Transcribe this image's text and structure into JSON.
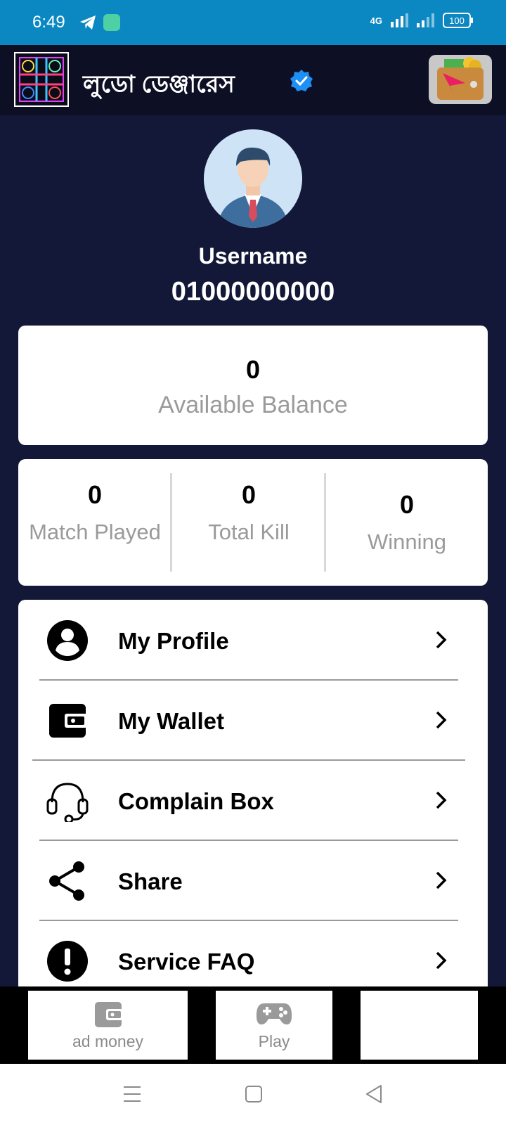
{
  "status_bar": {
    "time": "6:49",
    "network": "4G",
    "battery": "100"
  },
  "app_bar": {
    "title": "লুডো ডেঞ্জারেস"
  },
  "profile": {
    "username": "Username",
    "phone": "01000000000"
  },
  "balance": {
    "value": "0",
    "label": "Available Balance"
  },
  "stats": [
    {
      "value": "0",
      "label": "Match Played"
    },
    {
      "value": "0",
      "label": "Total Kill"
    },
    {
      "value": "0",
      "label": "Winning"
    }
  ],
  "menu": [
    {
      "label": "My Profile",
      "icon": "account-circle-icon"
    },
    {
      "label": "My Wallet",
      "icon": "wallet-icon"
    },
    {
      "label": "Complain Box",
      "icon": "headset-icon"
    },
    {
      "label": "Share",
      "icon": "share-icon"
    },
    {
      "label": "Service FAQ",
      "icon": "alert-circle-icon"
    }
  ],
  "bottom_nav": [
    {
      "label": "ad money",
      "icon": "wallet-icon"
    },
    {
      "label": "Play",
      "icon": "gamepad-icon"
    },
    {
      "label": "",
      "icon": ""
    }
  ],
  "colors": {
    "status_bar": "#0b88c2",
    "app_bar": "#0d0f24",
    "background": "#141838",
    "verified": "#1e8ff5"
  }
}
